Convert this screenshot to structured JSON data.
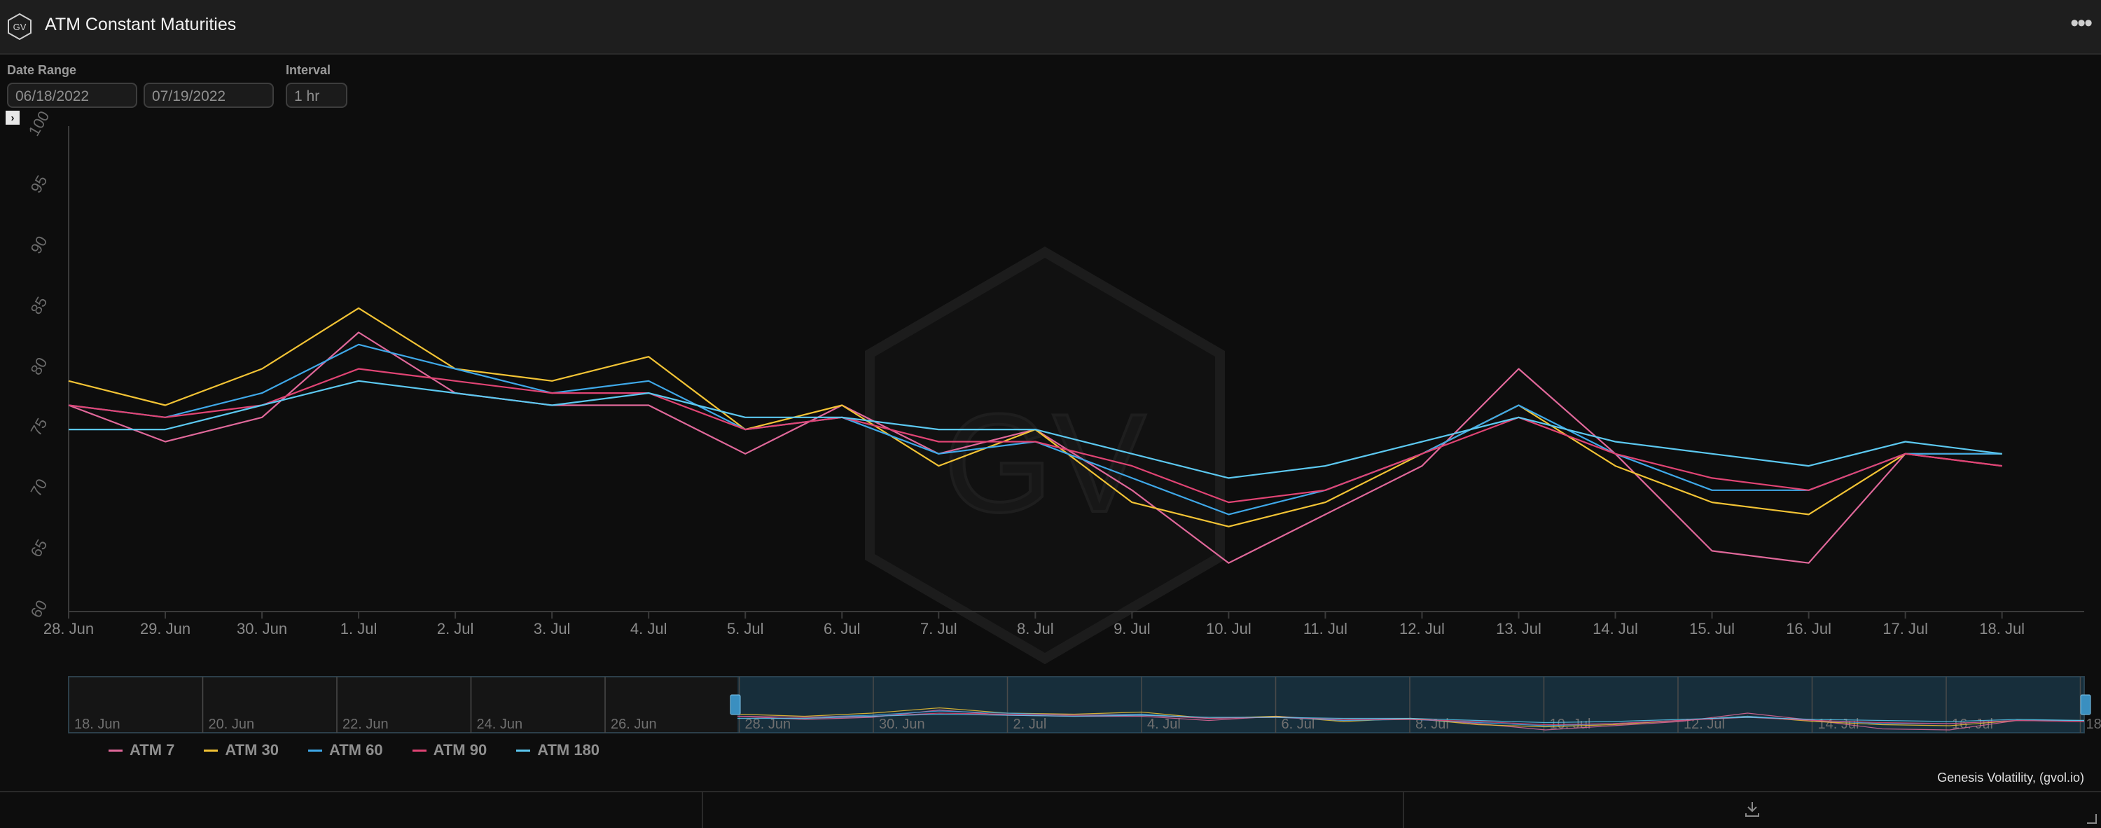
{
  "window": {
    "title": "ATM Constant Maturities",
    "logo_text": "GV",
    "menu_icon": "more-horizontal-icon"
  },
  "controls": {
    "date_range_label": "Date Range",
    "start_date": "06/18/2022",
    "end_date": "07/19/2022",
    "interval_label": "Interval",
    "interval": "1 hr"
  },
  "credit": "Genesis Volatility, (gvol.io)",
  "watermark_text": "GV",
  "colors": {
    "ATM 7": "#e0689a",
    "ATM 30": "#f2c335",
    "ATM 60": "#3fa8e8",
    "ATM 90": "#e04474",
    "ATM 180": "#5cc8f0"
  },
  "navigator_labels": [
    "18. Jun",
    "20. Jun",
    "22. Jun",
    "24. Jun",
    "26. Jun",
    "28. Jun",
    "30. Jun",
    "2. Jul",
    "4. Jul",
    "6. Jul",
    "8. Jul",
    "10. Jul",
    "12. Jul",
    "14. Jul",
    "16. Jul",
    "18"
  ],
  "chart_data": {
    "type": "line",
    "x_ticks": [
      "28. Jun",
      "29. Jun",
      "30. Jun",
      "1. Jul",
      "2. Jul",
      "3. Jul",
      "4. Jul",
      "5. Jul",
      "6. Jul",
      "7. Jul",
      "8. Jul",
      "9. Jul",
      "10. Jul",
      "11. Jul",
      "12. Jul",
      "13. Jul",
      "14. Jul",
      "15. Jul",
      "16. Jul",
      "17. Jul",
      "18. Jul"
    ],
    "y_ticks": [
      60,
      65,
      70,
      75,
      80,
      85,
      90,
      95,
      100
    ],
    "ylim": [
      60,
      100
    ],
    "x": [
      "28. Jun",
      "29. Jun",
      "30. Jun",
      "1. Jul",
      "2. Jul",
      "3. Jul",
      "4. Jul",
      "5. Jul",
      "6. Jul",
      "7. Jul",
      "8. Jul",
      "9. Jul",
      "10. Jul",
      "11. Jul",
      "12. Jul",
      "13. Jul",
      "14. Jul",
      "15. Jul",
      "16. Jul",
      "17. Jul",
      "18. Jul"
    ],
    "series": [
      {
        "name": "ATM 7",
        "values": [
          77,
          74,
          76,
          83,
          78,
          77,
          77,
          73,
          77,
          73,
          75,
          70,
          64,
          68,
          72,
          80,
          73,
          65,
          64,
          73,
          72
        ]
      },
      {
        "name": "ATM 30",
        "values": [
          79,
          77,
          80,
          85,
          80,
          79,
          81,
          75,
          77,
          72,
          75,
          69,
          67,
          69,
          73,
          77,
          72,
          69,
          68,
          73,
          73
        ]
      },
      {
        "name": "ATM 60",
        "values": [
          77,
          76,
          78,
          82,
          80,
          78,
          79,
          75,
          76,
          73,
          74,
          71,
          68,
          70,
          73,
          77,
          73,
          70,
          70,
          73,
          73
        ]
      },
      {
        "name": "ATM 90",
        "values": [
          77,
          76,
          77,
          80,
          79,
          78,
          78,
          75,
          76,
          74,
          74,
          72,
          69,
          70,
          73,
          76,
          73,
          71,
          70,
          73,
          72
        ]
      },
      {
        "name": "ATM 180",
        "values": [
          75,
          75,
          77,
          79,
          78,
          77,
          78,
          76,
          76,
          75,
          75,
          73,
          71,
          72,
          74,
          76,
          74,
          73,
          72,
          74,
          73
        ]
      }
    ],
    "grid": false,
    "legend": "bottom-left"
  }
}
